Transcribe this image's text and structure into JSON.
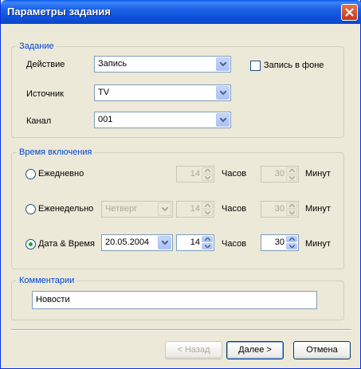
{
  "window": {
    "title": "Параметры задания"
  },
  "task": {
    "legend": "Задание",
    "action_label": "Действие",
    "action_value": "Запись",
    "background_record_label": "Запись в фоне",
    "source_label": "Источник",
    "source_value": "TV",
    "channel_label": "Канал",
    "channel_value": "001"
  },
  "schedule": {
    "legend": "Время включения",
    "daily": {
      "label": "Ежедневно",
      "hours": "14",
      "hours_label": "Часов",
      "minutes": "30",
      "minutes_label": "Минут",
      "selected": false
    },
    "weekly": {
      "label": "Еженедельно",
      "day": "Четверг",
      "hours": "14",
      "hours_label": "Часов",
      "minutes": "30",
      "minutes_label": "Минут",
      "selected": false
    },
    "datetime": {
      "label": "Дата & Время",
      "date": "20.05.2004",
      "hours": "14",
      "hours_label": "Часов",
      "minutes": "30",
      "minutes_label": "Минут",
      "selected": true
    }
  },
  "comments": {
    "legend": "Комментарии",
    "value": "Новости"
  },
  "buttons": {
    "back": "< Назад",
    "next": "Далее >",
    "cancel": "Отмена"
  },
  "colors": {
    "title_bar": "#0b47c7",
    "legend_text": "#0046d5",
    "dialog_bg": "#ece9d8",
    "radio_selected": "#21a121"
  }
}
